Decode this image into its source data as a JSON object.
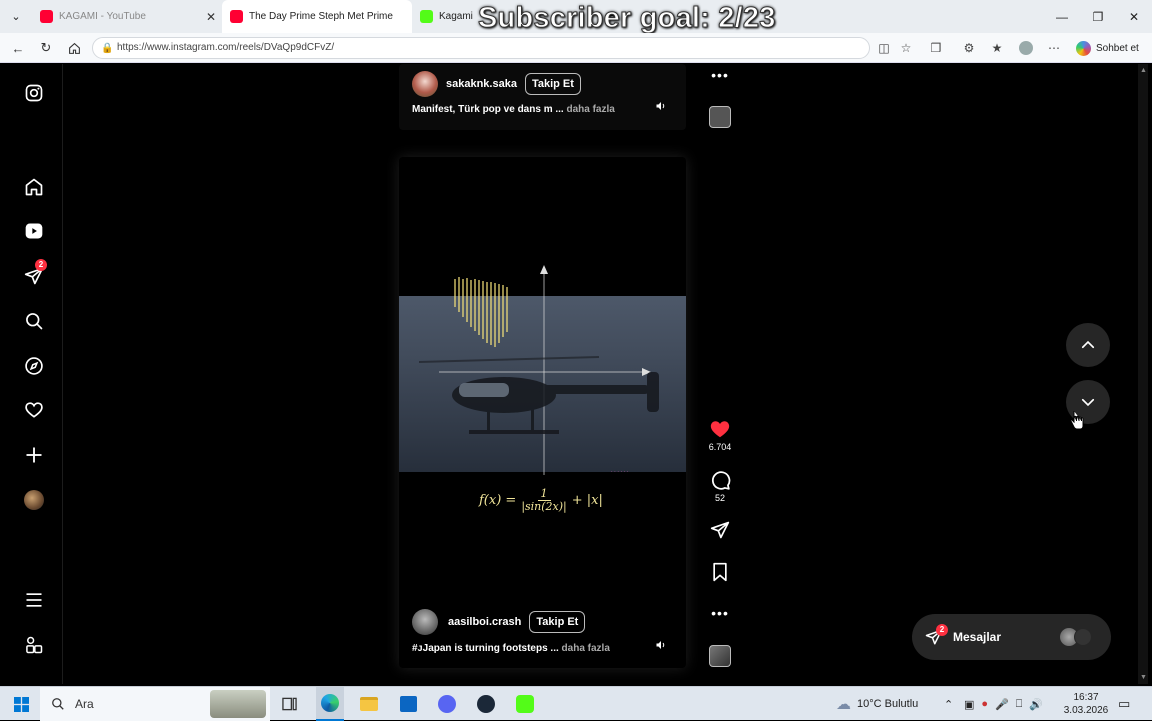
{
  "browser": {
    "tabs": [
      {
        "title": "KAGAMI - YouTube",
        "color": "#ff0033"
      },
      {
        "title": "The Day Prime Steph Met Prime Le",
        "color": "#ff0033"
      },
      {
        "title": "Kagami",
        "color": "#53fc18"
      }
    ],
    "overlay_text": "Subscriber goal: 2/23",
    "url": "https://www.instagram.com/reels/DVaQp9dCFvZ/",
    "chat_label": "Sohbet et"
  },
  "nav": {
    "notification_count": "2"
  },
  "reels": {
    "top": {
      "username": "sakaknk.saka",
      "follow_label": "Takip Et",
      "caption": "Manifest, Türk pop ve dans m ...",
      "more_label": "daha fazla"
    },
    "main": {
      "formula": "f(x) = 1/|sin(2x)| + |x|",
      "likes": "6.704",
      "comments": "52",
      "username": "aasilboi.crash",
      "follow_label": "Takip Et",
      "caption": "#ᴊJapan is turning footsteps ...",
      "more_label": "daha fazla"
    }
  },
  "messages": {
    "label": "Mesajlar",
    "badge": "2"
  },
  "taskbar": {
    "search_placeholder": "Ara",
    "weather": "10°C Bulutlu",
    "time": "16:37",
    "date": "3.03.2026"
  },
  "colors": {
    "like": "#ff3040",
    "badge": "#ff3040",
    "edge_blue": "#0078d4"
  }
}
